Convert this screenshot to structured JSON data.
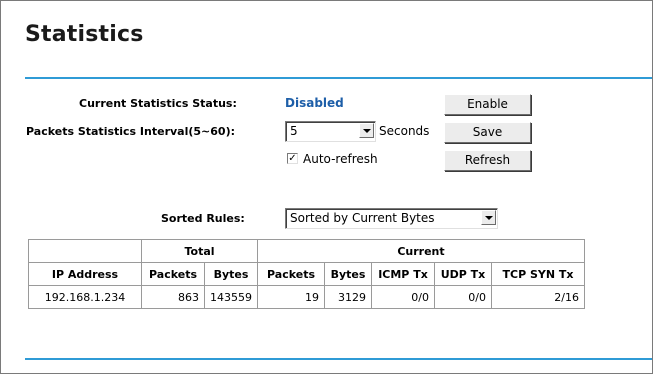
{
  "page": {
    "title": "Statistics"
  },
  "status": {
    "label": "Current Statistics Status:",
    "value": "Disabled",
    "enable_button": "Enable"
  },
  "interval": {
    "label": "Packets Statistics Interval(5~60):",
    "selected": "5",
    "unit": "Seconds",
    "save_button": "Save"
  },
  "autorefresh": {
    "label": "Auto-refresh",
    "checked": true,
    "check_glyph": "✓",
    "refresh_button": "Refresh"
  },
  "sort": {
    "label": "Sorted Rules:",
    "selected": "Sorted by Current Bytes"
  },
  "table": {
    "group_headers": {
      "total": "Total",
      "current": "Current"
    },
    "columns": [
      "IP Address",
      "Packets",
      "Bytes",
      "Packets",
      "Bytes",
      "ICMP Tx",
      "UDP Tx",
      "TCP SYN Tx"
    ],
    "rows": [
      [
        "192.168.1.234",
        "863",
        "143559",
        "19",
        "3129",
        "0/0",
        "0/0",
        "2/16"
      ]
    ]
  },
  "colors": {
    "accent_line": "#2f9bd6",
    "status_text": "#1d5ea8"
  }
}
